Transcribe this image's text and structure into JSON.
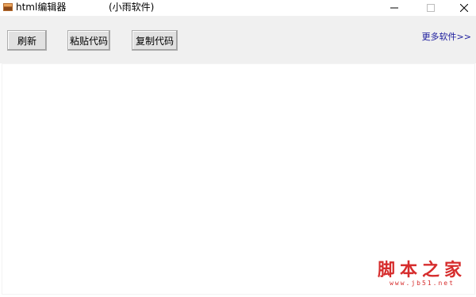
{
  "window": {
    "title": "html编辑器",
    "subtitle": "(小雨软件)",
    "icon": "app-book-icon",
    "controls": [
      "minimize-icon",
      "maximize-icon",
      "close-icon"
    ]
  },
  "toolbar": {
    "refresh_label": "刷新",
    "paste_label": "粘贴代码",
    "copy_label": "复制代码",
    "more_software_label": "更多软件>>",
    "link_color": "#1a1a9c"
  },
  "editor": {
    "content": ""
  },
  "watermark": {
    "main": "脚本之家",
    "sub": "www.jb51.net",
    "color": "#d62d2d"
  }
}
